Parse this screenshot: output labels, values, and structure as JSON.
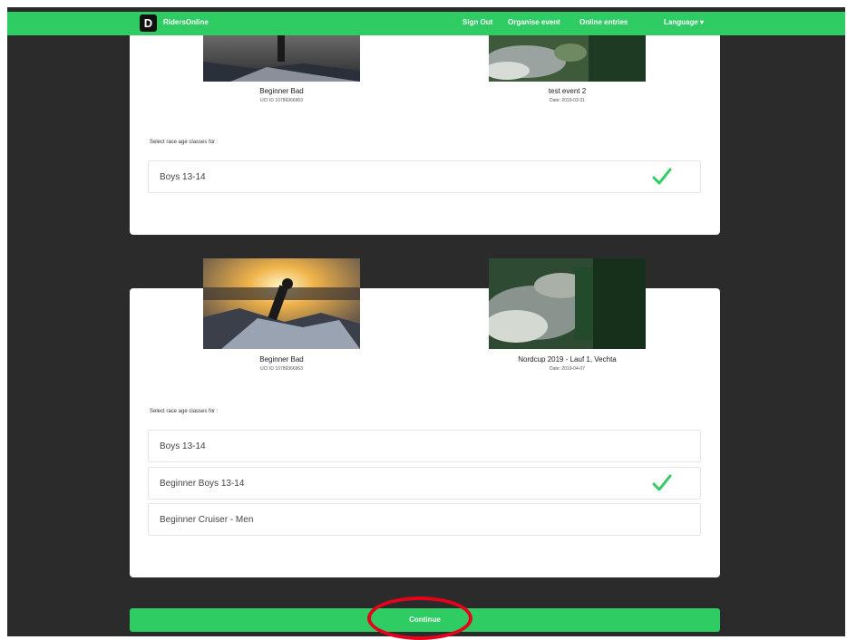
{
  "navbar": {
    "brand": "RidersOnline",
    "links": [
      "Sign Out",
      "Organise event",
      "Online entries",
      "Language ▾"
    ]
  },
  "entries": [
    {
      "rider_name": "Beginner Bad",
      "rider_uci": "UCI ID 10789366963",
      "event_name": "test event 2",
      "event_date": "Date: 2019-03-31",
      "select_label": "Select race age classes for :",
      "classes": [
        {
          "label": "Boys 13-14",
          "selected": true
        }
      ]
    },
    {
      "rider_name": "Beginner Bad",
      "rider_uci": "UCI ID 10789366963",
      "event_name": "Nordcup 2019 - Lauf 1, Vechta",
      "event_date": "Date: 2019-04-07",
      "select_label": "Select race age classes for :",
      "classes": [
        {
          "label": "Boys 13-14",
          "selected": false
        },
        {
          "label": "Beginner Boys 13-14",
          "selected": true
        },
        {
          "label": "Beginner Cruiser - Men",
          "selected": false
        }
      ]
    }
  ],
  "continue_label": "Continue",
  "colors": {
    "accent": "#2ecc63",
    "highlight": "#e6001b",
    "background": "#2b2b2b"
  }
}
